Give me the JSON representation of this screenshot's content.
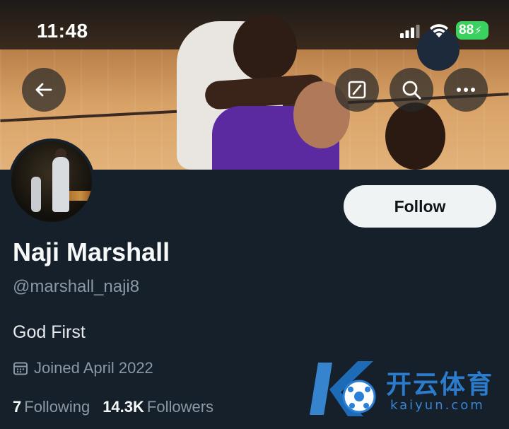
{
  "status_bar": {
    "time": "11:48",
    "battery": "88"
  },
  "profile": {
    "name": "Naji Marshall",
    "handle": "@marshall_naji8",
    "bio": "God First",
    "joined": "Joined April 2022",
    "following_count": "7",
    "following_label": "Following",
    "followers_count": "14.3K",
    "followers_label": "Followers"
  },
  "actions": {
    "follow_label": "Follow"
  },
  "icons": {
    "back": "back-arrow-icon",
    "grok": "grok-icon",
    "search": "search-icon",
    "more": "more-icon",
    "calendar": "calendar-icon"
  },
  "watermark": {
    "brand": "开云体育",
    "url": "kaiyun.com"
  },
  "colors": {
    "background": "#15202b",
    "follow_button": "#eff3f4",
    "secondary_text": "#8b98a5",
    "battery": "#3bd15e"
  }
}
